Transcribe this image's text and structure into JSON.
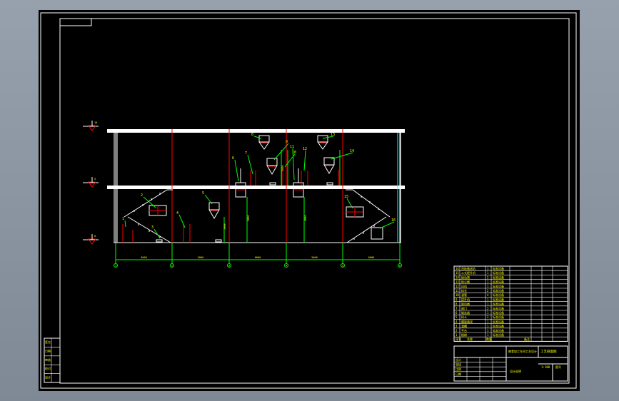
{
  "colors": {
    "background": "#000000",
    "frame": "#ffffff",
    "axis": "#00ff00",
    "column": "#ff0000",
    "label": "#ffff00",
    "equipment": "#ffffff",
    "slab": "#ffffff"
  },
  "viewport": {
    "name": "cad-model-space"
  },
  "axes": [
    "1",
    "2",
    "3",
    "4",
    "5",
    "6"
  ],
  "dimensions": [
    "6000",
    "5000",
    "6000",
    "5000",
    "6000"
  ],
  "levels": [
    "0",
    "5",
    "10"
  ],
  "equipment_tags": [
    "1",
    "2",
    "3",
    "4",
    "5",
    "6",
    "7",
    "8",
    "9",
    "10",
    "11",
    "12",
    "13",
    "14",
    "15",
    "16"
  ],
  "vertical_texts": [
    "2000",
    "3000",
    "4000",
    "3000"
  ],
  "parts_list": {
    "row_numbers": [
      "16",
      "15",
      "14",
      "13",
      "12",
      "11",
      "10",
      "9",
      "8",
      "7",
      "6",
      "5",
      "4",
      "3",
      "2",
      "1"
    ],
    "names": [
      "刮板输送机",
      "斗式提升机",
      "振动筛",
      "除尘器",
      "风机",
      "料仓",
      "溜管",
      "提升机",
      "旋风器",
      "闸门",
      "磁选器",
      "料斗",
      "螺旋输送",
      "溜槽",
      "平台",
      "楼梯"
    ],
    "qty": [
      "1",
      "1",
      "2",
      "1",
      "1",
      "2",
      "4",
      "1",
      "1",
      "2",
      "1",
      "2",
      "1",
      "1",
      "1",
      "1"
    ],
    "spec": [
      "标准设备",
      "标准设备",
      "标准设备",
      "标准设备",
      "标准设备",
      "标准设备",
      "标准设备",
      "标准设备",
      "标准设备",
      "标准设备",
      "标准设备",
      "标准设备",
      "标准设备",
      "标准设备",
      "标准设备",
      "标准设备"
    ],
    "header": [
      "序号",
      "名称",
      "数量",
      "备注"
    ]
  },
  "title_block": {
    "title": "工艺剖面图",
    "project": "粮食加工车间工艺设计",
    "scale": "1:100",
    "sheet": "图号",
    "school": "设计说明",
    "fields": [
      "设计",
      "审核",
      "比例",
      "日期"
    ]
  },
  "left_stamp": [
    "签名",
    "日期",
    "审核",
    "校对",
    "设计"
  ]
}
